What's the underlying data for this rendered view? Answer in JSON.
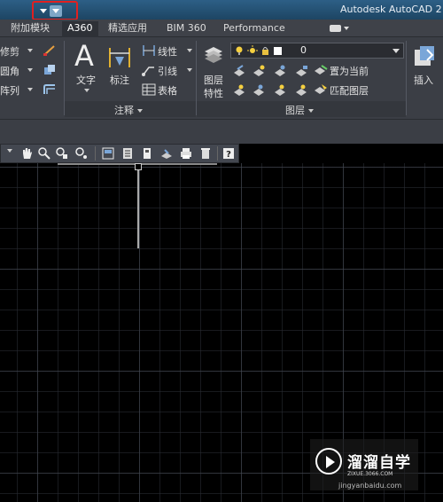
{
  "title_bar": {
    "app_title": "Autodesk AutoCAD 2"
  },
  "tabs": [
    {
      "label": "附加模块"
    },
    {
      "label": "A360"
    },
    {
      "label": "精选应用"
    },
    {
      "label": "BIM 360"
    },
    {
      "label": "Performance"
    }
  ],
  "ribbon": {
    "modify": {
      "trim": "修剪",
      "fillet": "圆角",
      "array": "阵列"
    },
    "annotation": {
      "text": "文字",
      "dimension": "标注",
      "linear": "线性",
      "leader": "引线",
      "table": "表格",
      "panel_title": "注释"
    },
    "layers": {
      "layer_properties_line1": "图层",
      "layer_properties_line2": "特性",
      "current_layer": "0",
      "set_current": "置为当前",
      "match_layer": "匹配图层",
      "panel_title": "图层"
    },
    "insert": {
      "label": "插入"
    }
  },
  "watermark": {
    "brand": "溜溜自学",
    "url": "ZIXUE.3066.COM",
    "footer": "jingyanbaidu.com"
  },
  "colors": {
    "title_bar": "#1d4563",
    "ribbon_bg": "#3b3e45",
    "canvas_bg": "#000000",
    "highlight_box": "#e02020"
  }
}
